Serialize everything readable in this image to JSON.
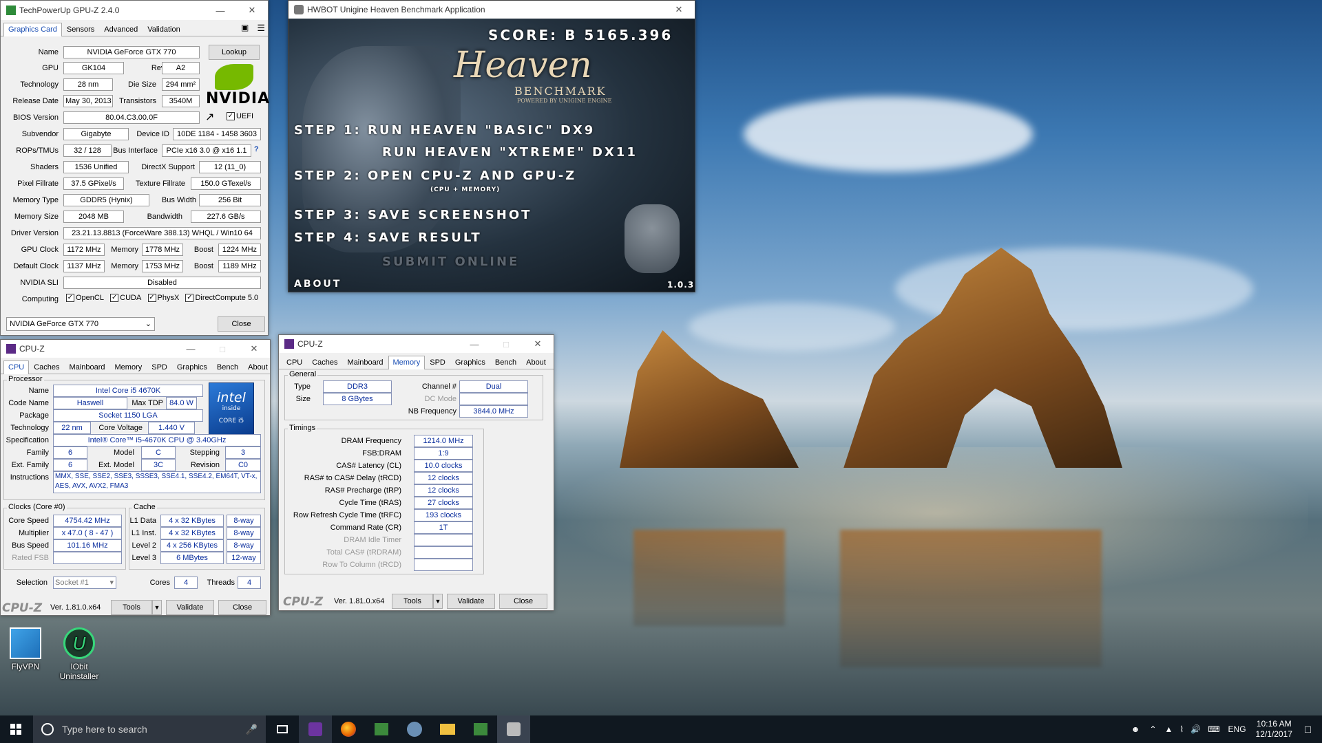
{
  "gpuz": {
    "title": "TechPowerUp GPU-Z 2.4.0",
    "tabs": [
      "Graphics Card",
      "Sensors",
      "Advanced",
      "Validation"
    ],
    "fields": {
      "name_l": "Name",
      "name": "NVIDIA GeForce GTX 770",
      "lookup": "Lookup",
      "gpu_l": "GPU",
      "gpu": "GK104",
      "rev_l": "Revision",
      "rev": "A2",
      "tech_l": "Technology",
      "tech": "28 nm",
      "die_l": "Die Size",
      "die": "294 mm²",
      "rel_l": "Release Date",
      "rel": "May 30, 2013",
      "trans_l": "Transistors",
      "trans": "3540M",
      "bios_l": "BIOS Version",
      "bios": "80.04.C3.00.0F",
      "uefi": "UEFI",
      "sub_l": "Subvendor",
      "sub": "Gigabyte",
      "dev_l": "Device ID",
      "dev": "10DE 1184 - 1458 3603",
      "rops_l": "ROPs/TMUs",
      "rops": "32 / 128",
      "bus_l": "Bus Interface",
      "bus": "PCIe x16 3.0 @ x16 1.1",
      "help": "?",
      "sh_l": "Shaders",
      "sh": "1536 Unified",
      "dx_l": "DirectX Support",
      "dx": "12 (11_0)",
      "pf_l": "Pixel Fillrate",
      "pf": "37.5 GPixel/s",
      "tf_l": "Texture Fillrate",
      "tf": "150.0 GTexel/s",
      "mt_l": "Memory Type",
      "mt": "GDDR5 (Hynix)",
      "bw_l": "Bus Width",
      "bw": "256 Bit",
      "ms_l": "Memory Size",
      "ms": "2048 MB",
      "band_l": "Bandwidth",
      "band": "227.6 GB/s",
      "drv_l": "Driver Version",
      "drv": "23.21.13.8813 (ForceWare 388.13) WHQL / Win10 64",
      "gc_l": "GPU Clock",
      "gc": "1172 MHz",
      "mem_l": "Memory",
      "gcm": "1778 MHz",
      "boost_l": "Boost",
      "gcb": "1224 MHz",
      "dc_l": "Default Clock",
      "dc": "1137 MHz",
      "dcm": "1753 MHz",
      "dcb": "1189 MHz",
      "sli_l": "NVIDIA SLI",
      "sli": "Disabled",
      "comp_l": "Computing",
      "opencl": "OpenCL",
      "cuda": "CUDA",
      "physx": "PhysX",
      "dcomp": "DirectCompute 5.0"
    },
    "select": "NVIDIA GeForce GTX 770",
    "close": "Close",
    "vendor": "NVIDIA"
  },
  "heaven": {
    "title": "HWBOT Unigine Heaven Benchmark Application",
    "score": "SCORE: B 5165.396",
    "logo": "Heaven",
    "bench": "BENCHMARK",
    "powered": "POWERED BY UNIGINE ENGINE",
    "s1a": "STEP 1: RUN HEAVEN \"BASIC\" DX9",
    "s1b": "RUN HEAVEN \"XTREME\" DX11",
    "s2": "STEP 2: OPEN CPU-Z AND GPU-Z",
    "s2sub": "(CPU + MEMORY)",
    "s3": "STEP 3: SAVE SCREENSHOT",
    "s4": "STEP 4: SAVE RESULT",
    "s5": "SUBMIT ONLINE",
    "about": "ABOUT",
    "ver": "1.0.3"
  },
  "cpuz1": {
    "title": "CPU-Z",
    "tabs": [
      "CPU",
      "Caches",
      "Mainboard",
      "Memory",
      "SPD",
      "Graphics",
      "Bench",
      "About"
    ],
    "proc": "Processor",
    "name_l": "Name",
    "name": "Intel Core i5 4670K",
    "code_l": "Code Name",
    "code": "Haswell",
    "tdp_l": "Max TDP",
    "tdp": "84.0 W",
    "pkg_l": "Package",
    "pkg": "Socket 1150 LGA",
    "tech_l": "Technology",
    "tech": "22 nm",
    "cv_l": "Core Voltage",
    "cv": "1.440 V",
    "spec_l": "Specification",
    "spec": "Intel® Core™ i5-4670K CPU @ 3.40GHz",
    "fam_l": "Family",
    "fam": "6",
    "mod_l": "Model",
    "mod": "C",
    "step_l": "Stepping",
    "step": "3",
    "efam_l": "Ext. Family",
    "efam": "6",
    "emod_l": "Ext. Model",
    "emod": "3C",
    "rev_l": "Revision",
    "rev": "C0",
    "ins_l": "Instructions",
    "ins": "MMX, SSE, SSE2, SSE3, SSSE3, SSE4.1, SSE4.2, EM64T, VT-x, AES, AVX, AVX2, FMA3",
    "clk": "Clocks (Core #0)",
    "cs_l": "Core Speed",
    "cs": "4754.42 MHz",
    "mul_l": "Multiplier",
    "mul": "x 47.0 ( 8 - 47 )",
    "bs_l": "Bus Speed",
    "bs": "101.16 MHz",
    "rf_l": "Rated FSB",
    "cache": "Cache",
    "l1d_l": "L1 Data",
    "l1d": "4 x 32 KBytes",
    "l1d_w": "8-way",
    "l1i_l": "L1 Inst.",
    "l1i": "4 x 32 KBytes",
    "l1i_w": "8-way",
    "l2_l": "Level 2",
    "l2": "4 x 256 KBytes",
    "l2_w": "8-way",
    "l3_l": "Level 3",
    "l3": "6 MBytes",
    "l3_w": "12-way",
    "sel_l": "Selection",
    "sel": "Socket #1",
    "cores_l": "Cores",
    "cores": "4",
    "thr_l": "Threads",
    "thr": "4",
    "logo": "CPU-Z",
    "ver": "Ver. 1.81.0.x64",
    "tools": "Tools",
    "validate": "Validate",
    "close": "Close",
    "intel1": "intel",
    "intel2": "inside",
    "intel3": "CORE i5"
  },
  "cpuz2": {
    "title": "CPU-Z",
    "tabs": [
      "CPU",
      "Caches",
      "Mainboard",
      "Memory",
      "SPD",
      "Graphics",
      "Bench",
      "About"
    ],
    "gen": "General",
    "type_l": "Type",
    "type": "DDR3",
    "ch_l": "Channel #",
    "ch": "Dual",
    "size_l": "Size",
    "size": "8 GBytes",
    "dc_l": "DC Mode",
    "nb_l": "NB Frequency",
    "nb": "3844.0 MHz",
    "tim": "Timings",
    "df_l": "DRAM Frequency",
    "df": "1214.0 MHz",
    "fsb_l": "FSB:DRAM",
    "fsb": "1:9",
    "cl_l": "CAS# Latency (CL)",
    "cl": "10.0 clocks",
    "rcd_l": "RAS# to CAS# Delay (tRCD)",
    "rcd": "12 clocks",
    "rp_l": "RAS# Precharge (tRP)",
    "rp": "12 clocks",
    "ras_l": "Cycle Time (tRAS)",
    "ras": "27 clocks",
    "rfc_l": "Row Refresh Cycle Time (tRFC)",
    "rfc": "193 clocks",
    "cr_l": "Command Rate (CR)",
    "cr": "1T",
    "idle_l": "DRAM Idle Timer",
    "tcas_l": "Total CAS# (tRDRAM)",
    "rtc_l": "Row To Column (tRCD)",
    "logo": "CPU-Z",
    "ver": "Ver. 1.81.0.x64",
    "tools": "Tools",
    "validate": "Validate",
    "close": "Close"
  },
  "desktop": {
    "icon1": "FlyVPN",
    "icon2a": "IObit",
    "icon2b": "Uninstaller"
  },
  "taskbar": {
    "search": "Type here to search",
    "lang": "ENG",
    "time": "10:16 AM",
    "date": "12/1/2017"
  }
}
